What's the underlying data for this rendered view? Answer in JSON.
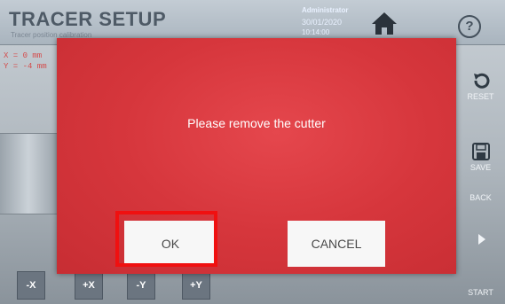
{
  "header": {
    "title": "TRACER SETUP",
    "subtitle": "Tracer position calibration",
    "user": "Administrator",
    "date": "30/01/2020",
    "time": "10:14:00",
    "home_icon": "home-icon",
    "help_label": "?"
  },
  "coordinates": {
    "x": "X = 0 mm",
    "y": "Y = -4 mm"
  },
  "side_menu": {
    "reset_label": "RESET",
    "save_label": "SAVE",
    "back_label": "BACK",
    "start_label": "START"
  },
  "jog_buttons": {
    "minus_x": "-X",
    "plus_x": "+X",
    "minus_y": "-Y",
    "plus_y": "+Y"
  },
  "dialog": {
    "message": "Please remove the cutter",
    "ok_label": "OK",
    "cancel_label": "CANCEL",
    "background_color": "#d6363c",
    "highlight_color": "#f01010"
  }
}
